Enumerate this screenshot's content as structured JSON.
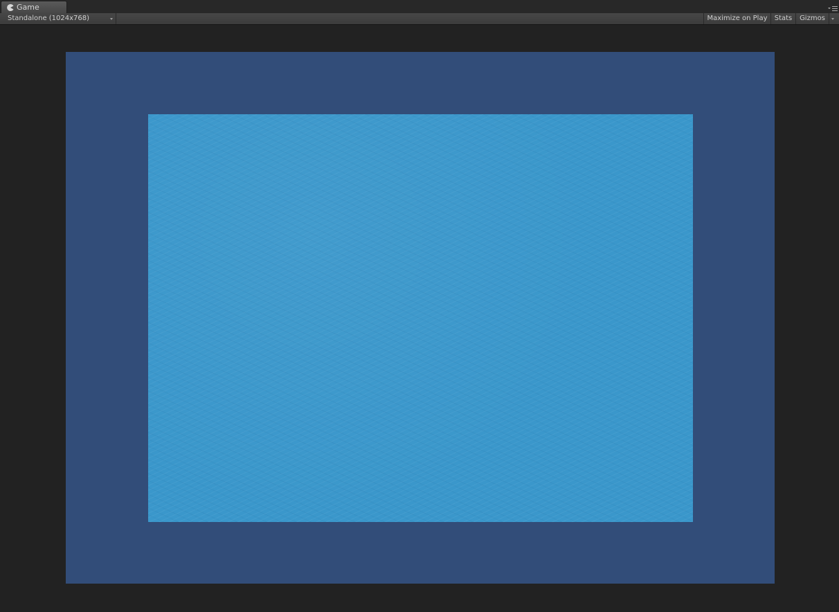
{
  "window": {
    "tab_label": "Game",
    "tab_icon": "pacman-icon"
  },
  "toolbar": {
    "aspect_dropdown": "Standalone (1024x768)",
    "maximize_on_play": "Maximize on Play",
    "stats": "Stats",
    "gizmos": "Gizmos"
  },
  "colors": {
    "viewport_background": "#324d79",
    "water": "#3a97cb",
    "editor_background": "#222222"
  }
}
